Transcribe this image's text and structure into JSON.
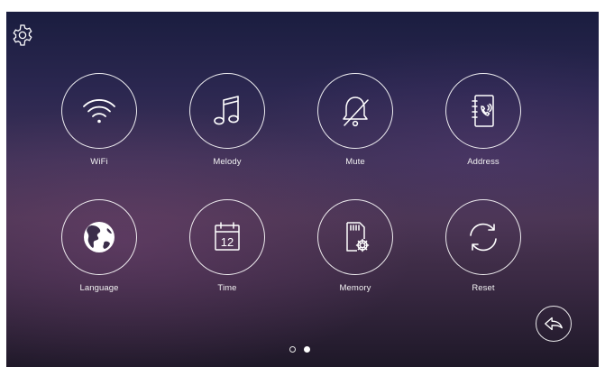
{
  "header": {
    "settings_icon": "gear-icon"
  },
  "menu": {
    "items": [
      {
        "label": "WiFi",
        "icon": "wifi-icon"
      },
      {
        "label": "Melody",
        "icon": "music-note-icon"
      },
      {
        "label": "Mute",
        "icon": "bell-muted-icon"
      },
      {
        "label": "Address",
        "icon": "address-book-icon"
      },
      {
        "label": "Language",
        "icon": "globe-icon"
      },
      {
        "label": "Time",
        "icon": "calendar-icon",
        "calendar_day": "12"
      },
      {
        "label": "Memory",
        "icon": "sd-card-settings-icon"
      },
      {
        "label": "Reset",
        "icon": "refresh-icon"
      }
    ]
  },
  "pagination": {
    "page_count": 2,
    "current_page": 2
  },
  "footer": {
    "back_icon": "back-arrow-icon"
  },
  "colors": {
    "foreground": "#ffffff",
    "background_top": "#1a1d3f",
    "background_mid": "#4a3551"
  }
}
